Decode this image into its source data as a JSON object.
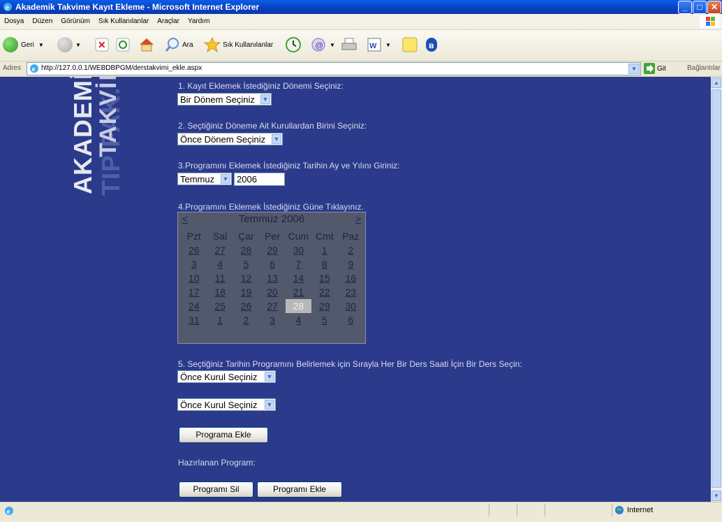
{
  "window": {
    "title": "Akademik Takvime Kayıt Ekleme - Microsoft Internet Explorer",
    "minimize_icon": "minimize-icon",
    "maximize_icon": "maximize-icon",
    "close_icon": "close-icon"
  },
  "menu": [
    "Dosya",
    "Düzen",
    "Görünüm",
    "Sık Kullanılanlar",
    "Araçlar",
    "Yardım"
  ],
  "toolbar": {
    "back_label": "Geri",
    "search_label": "Ara",
    "favorites_label": "Sık Kullanılanlar"
  },
  "address": {
    "label": "Adres",
    "url": "http://127.0.0.1/WEBDBPGM/derstakvimi_ekle.aspx",
    "go_label": "Git",
    "links_label": "Bağlantılar"
  },
  "logo": {
    "line1": "TIP FAK.",
    "line2": "AKADEMİK YIL",
    "line3": "TAKVİMİ"
  },
  "form": {
    "step1_label": "1. Kayıt Eklemek İstediğiniz Dönemi Seçiniz:",
    "step1_value": "Bir Dönem Seçiniz",
    "step2_label": "2. Seçtiğiniz Döneme Ait Kurullardan Birini Seçiniz:",
    "step2_value": "Önce Dönem Seçiniz",
    "step3_label": "3.Programını Eklemek İstediğiniz Tarihin Ay ve Yılını Giriniz:",
    "month_value": "Temmuz",
    "year_value": "2006",
    "step4_label": "4.Programını Eklemek İstediğiniz Güne Tıklayınız.",
    "step5_label": "5. Seçtiğiniz Tarihin Programını Belirlemek için Sırayla Her Bir Ders Saati İçin Bir Ders Seçin:",
    "course1_value": "Önce Kurul Seçiniz",
    "course2_value": "Önce Kurul Seçiniz",
    "add_program_button": "Programa Ekle",
    "prepared_label": "Hazırlanan Program:",
    "delete_program_button": "Programı Sil",
    "save_program_button": "Programı Ekle"
  },
  "calendar": {
    "prev": "<",
    "next": ">",
    "month_title": "Temmuz 2006",
    "weekdays": [
      "Pzt",
      "Sal",
      "Çar",
      "Per",
      "Cum",
      "Cmt",
      "Paz"
    ],
    "weeks": [
      [
        "26",
        "27",
        "28",
        "29",
        "30",
        "1",
        "2"
      ],
      [
        "3",
        "4",
        "5",
        "6",
        "7",
        "8",
        "9"
      ],
      [
        "10",
        "11",
        "12",
        "13",
        "14",
        "15",
        "16"
      ],
      [
        "17",
        "18",
        "19",
        "20",
        "21",
        "22",
        "23"
      ],
      [
        "24",
        "25",
        "26",
        "27",
        "28",
        "29",
        "30"
      ],
      [
        "31",
        "1",
        "2",
        "3",
        "4",
        "5",
        "6"
      ]
    ],
    "selected": "28"
  },
  "status": {
    "zone": "Internet"
  },
  "colors": {
    "page_bg": "#2b3a8a",
    "calendar_bg": "#53596d",
    "titlebar": "#0a46d6"
  }
}
